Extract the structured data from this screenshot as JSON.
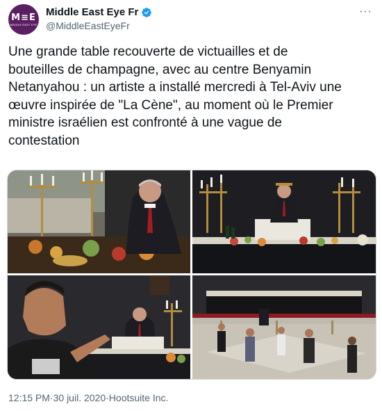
{
  "author": {
    "display_name": "Middle East Eye Fr",
    "handle": "@MiddleEastEyeFr",
    "avatar_mark": "M≡E",
    "avatar_subtext": "MIDDLE EAST EYE",
    "avatar_color": "#5a1f62",
    "verified_icon": "verified-badge-icon",
    "verified_color": "#1d9bf0"
  },
  "more_icon": "more-dots-icon",
  "tweet": {
    "text_lines": [
      "Une grande table recouverte de victuailles et de",
      "bouteilles de champagne, avec au centre Benyamin",
      "Netanyahou : un artiste a installé mercredi à Tel-Aviv une",
      "œuvre inspirée de \"La Cène\", au moment où le Premier",
      "ministre israélien est confronté à une vague de",
      "contestation"
    ]
  },
  "media": {
    "photos": [
      {
        "name": "photo-table-closeup"
      },
      {
        "name": "photo-table-wide"
      },
      {
        "name": "photo-selfie"
      },
      {
        "name": "photo-square-crowd"
      }
    ]
  },
  "meta": {
    "time": "12:15 PM",
    "separator": " · ",
    "date": "30 juil. 2020",
    "source": "Hootsuite Inc."
  },
  "colors": {
    "text": "#0f1419",
    "secondary_text": "#536471",
    "border": "#cfd9de"
  }
}
